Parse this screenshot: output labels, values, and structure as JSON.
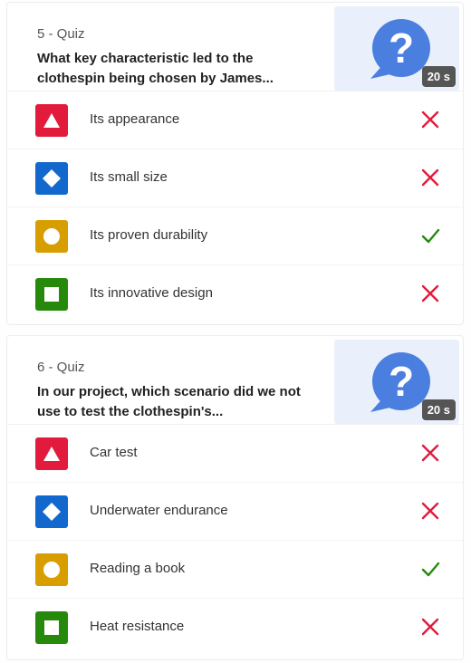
{
  "quizzes": [
    {
      "number_label": "5 - Quiz",
      "title": "What key characteristic led to the clothespin being chosen by James...",
      "timer": "20 s",
      "answers": [
        {
          "text": "Its appearance",
          "shape": "triangle",
          "color": "#e21b3c",
          "correct": false
        },
        {
          "text": "Its small size",
          "shape": "diamond",
          "color": "#1368ce",
          "correct": false
        },
        {
          "text": "Its proven durability",
          "shape": "circle",
          "color": "#d89e00",
          "correct": true
        },
        {
          "text": "Its innovative design",
          "shape": "square",
          "color": "#26890c",
          "correct": false
        }
      ]
    },
    {
      "number_label": "6 - Quiz",
      "title": "In our project, which scenario did we not use to test the clothespin's...",
      "timer": "20 s",
      "answers": [
        {
          "text": "Car test",
          "shape": "triangle",
          "color": "#e21b3c",
          "correct": false
        },
        {
          "text": "Underwater endurance",
          "shape": "diamond",
          "color": "#1368ce",
          "correct": false
        },
        {
          "text": "Reading a book",
          "shape": "circle",
          "color": "#d89e00",
          "correct": true
        },
        {
          "text": "Heat resistance",
          "shape": "square",
          "color": "#26890c",
          "correct": false
        }
      ]
    }
  ],
  "icons": {
    "thumbnail": "question-bubble-icon",
    "correct": "check-icon",
    "incorrect": "cross-icon"
  }
}
